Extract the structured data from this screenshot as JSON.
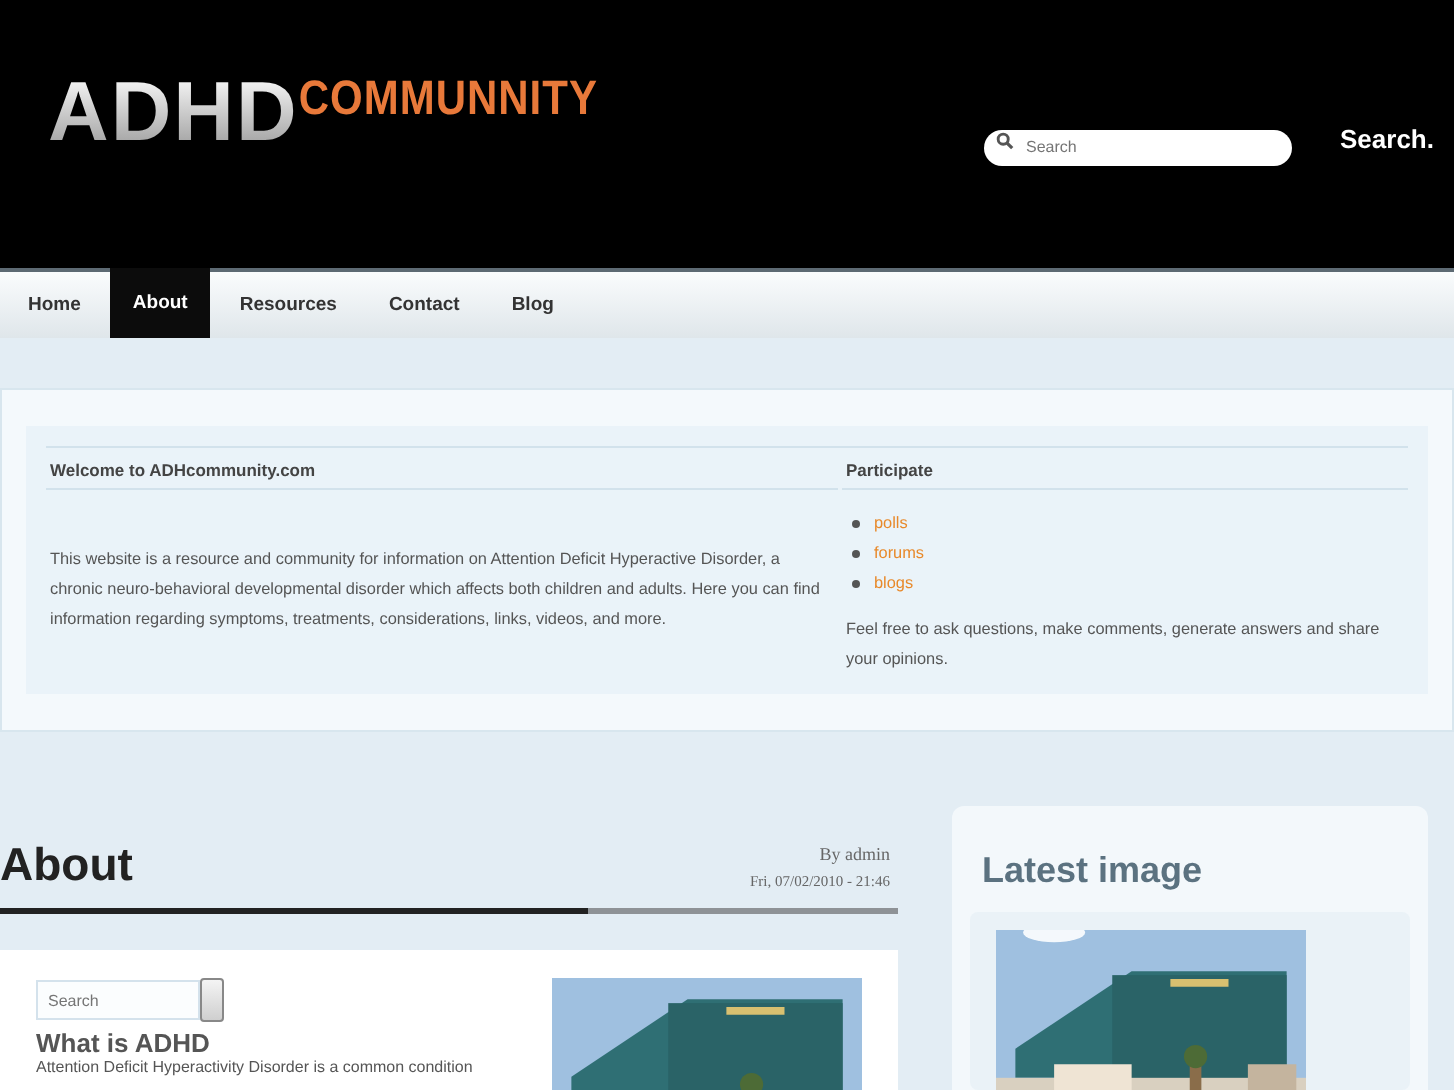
{
  "header": {
    "logo_main": "ADHD",
    "logo_accent": "COMMUNNITY",
    "search": {
      "placeholder": "Search"
    },
    "search_label": "Search."
  },
  "nav": [
    {
      "label": "Home",
      "selected": false
    },
    {
      "label": "About",
      "selected": true
    },
    {
      "label": "Resources",
      "selected": false
    },
    {
      "label": "Contact",
      "selected": false
    },
    {
      "label": "Blog",
      "selected": false
    }
  ],
  "welcome": {
    "title": "Welcome to ADHcommunity.com",
    "text": "This website is a resource and community for information on Attention Deficit Hyperactive Disorder, a chronic neuro-behavioral developmental disorder which affects both children and adults. Here you can find information regarding symptoms, treatments, considerations, links, videos, and more."
  },
  "participate": {
    "title": "Participate",
    "links": [
      "polls",
      "forums",
      "blogs"
    ],
    "text": "Feel free to ask questions, make comments, generate answers and share your opinions."
  },
  "article": {
    "title": "About",
    "author": "By admin",
    "date": "Fri, 07/02/2010 - 21:46",
    "search": {
      "placeholder": "Search"
    },
    "heading": "What is ADHD",
    "text": "Attention Deficit Hyperactivity Disorder is a common condition"
  },
  "sidebar": {
    "title": "Latest image"
  }
}
